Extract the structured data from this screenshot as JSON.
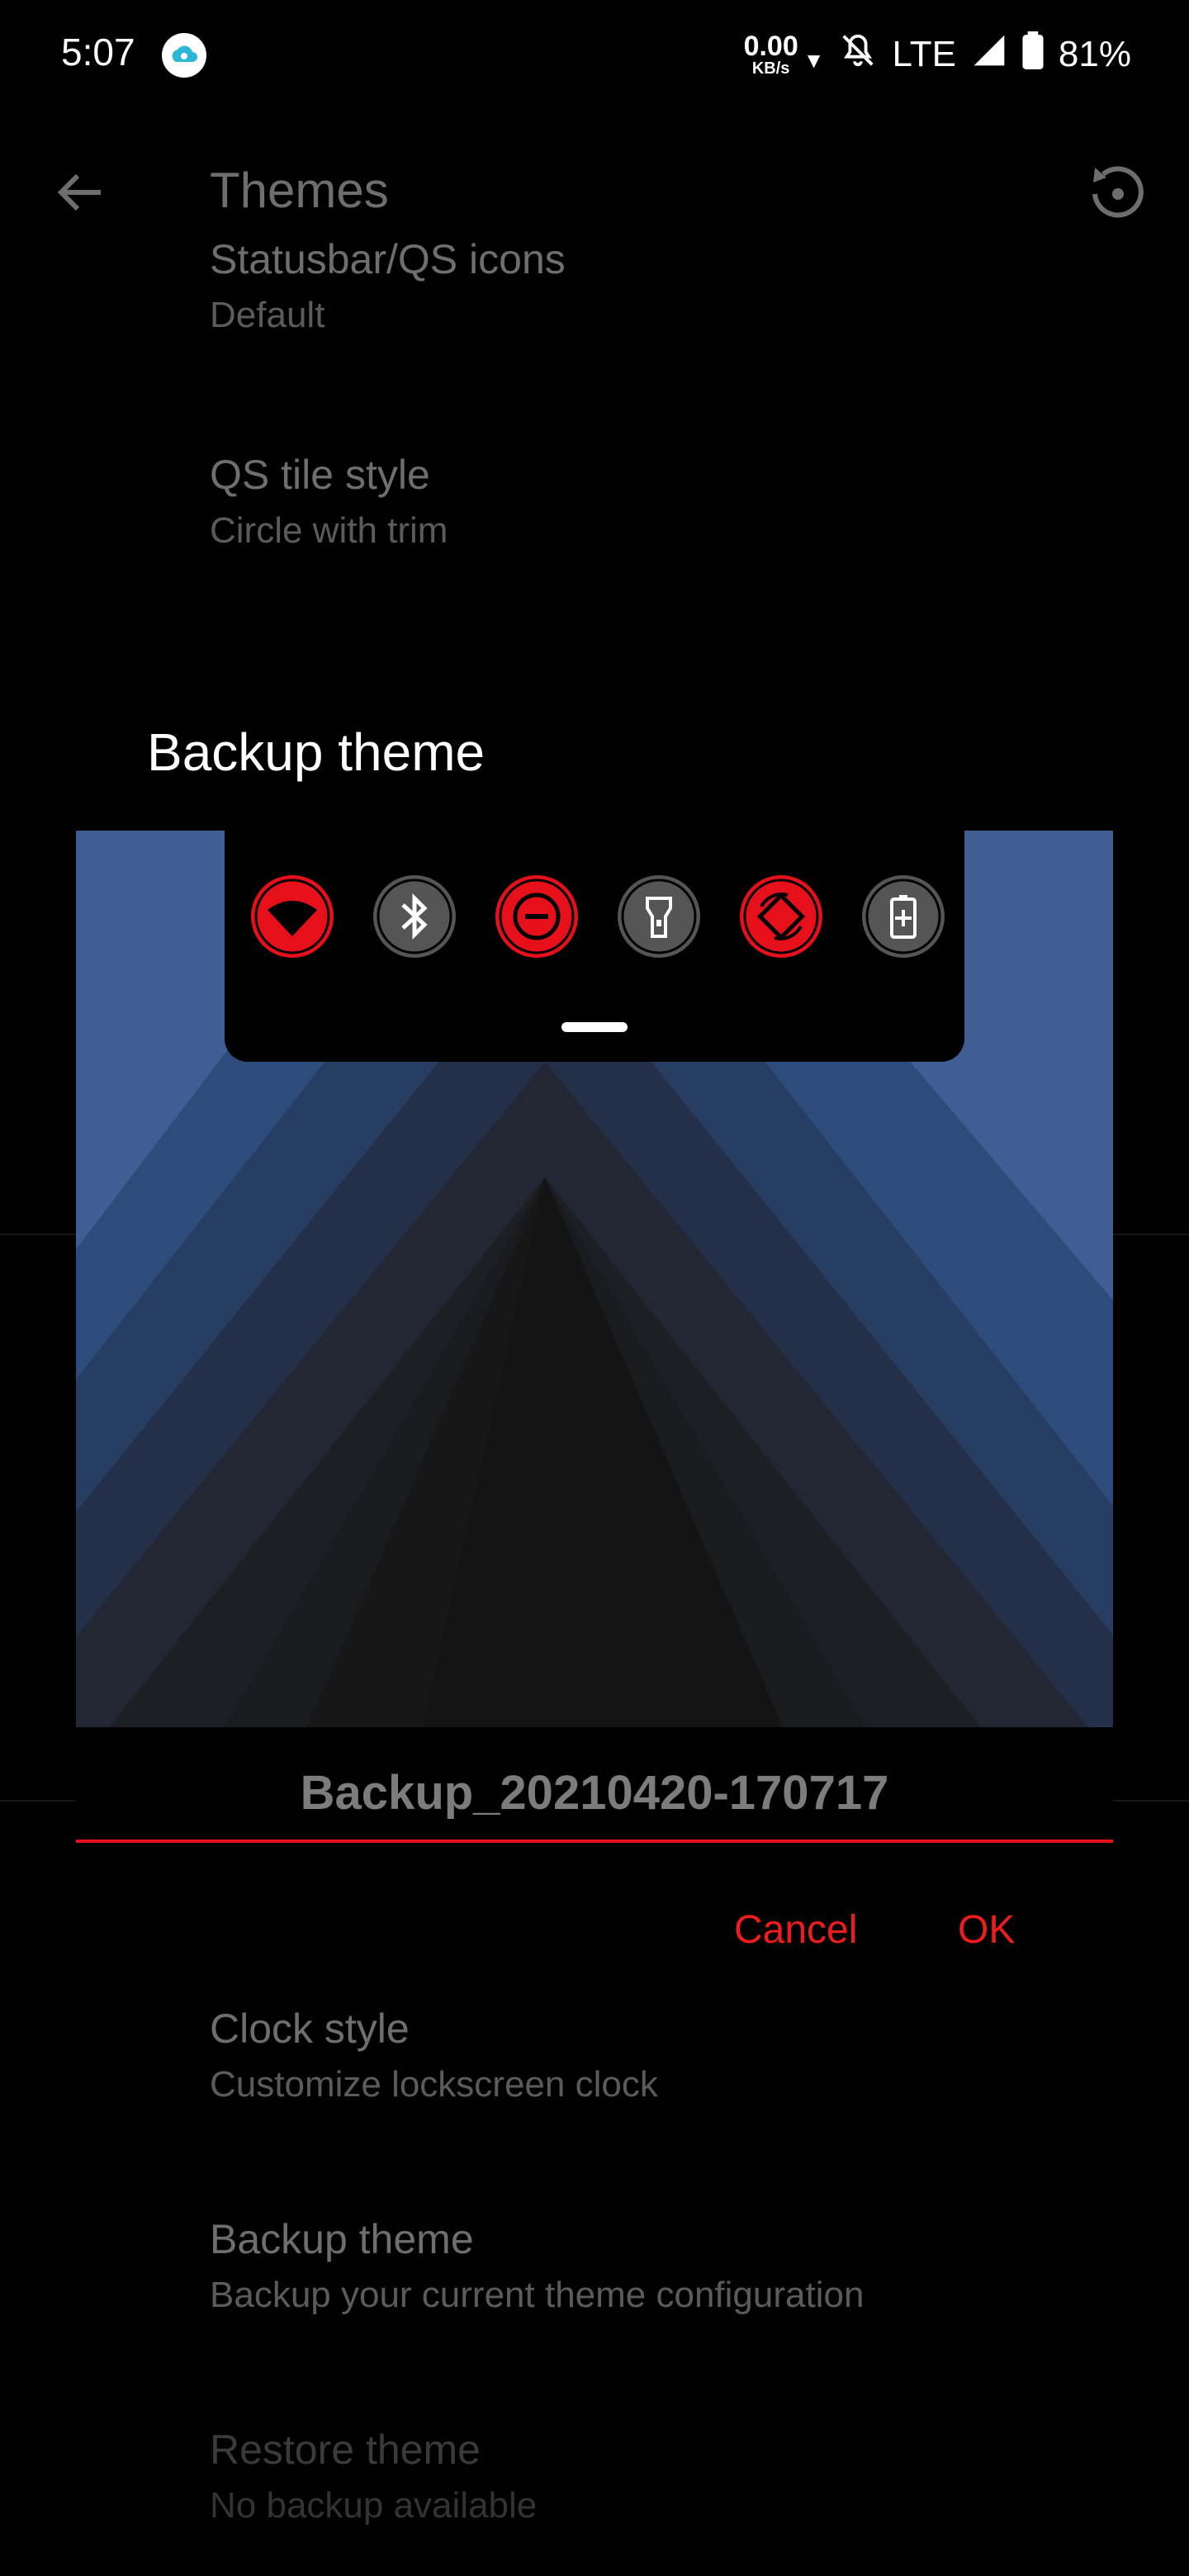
{
  "status_bar": {
    "time": "5:07",
    "net_speed_value": "0.00",
    "net_speed_unit": "KB/s",
    "network": "LTE",
    "battery": "81%"
  },
  "toolbar": {
    "title": "Themes"
  },
  "settings": [
    {
      "title": "Statusbar/QS icons",
      "summary": "Default"
    },
    {
      "title": "QS tile style",
      "summary": "Circle with trim"
    },
    {
      "title": "Clock style",
      "summary": "Customize lockscreen clock"
    },
    {
      "title": "Backup theme",
      "summary": "Backup your current theme configuration"
    },
    {
      "title": "Restore theme",
      "summary": "No backup available"
    }
  ],
  "dialog": {
    "title": "Backup theme",
    "name_value": "Backup_20210420-170717",
    "cancel_label": "Cancel",
    "ok_label": "OK",
    "qs_tiles": [
      {
        "icon": "wifi-icon",
        "active": true
      },
      {
        "icon": "bluetooth-icon",
        "active": false
      },
      {
        "icon": "dnd-icon",
        "active": true
      },
      {
        "icon": "flashlight-icon",
        "active": false
      },
      {
        "icon": "auto-rotate-icon",
        "active": true
      },
      {
        "icon": "battery-saver-icon",
        "active": false
      }
    ]
  },
  "colors": {
    "accent": "#e5101a",
    "background": "#000000",
    "tile_inactive": "#555555"
  }
}
